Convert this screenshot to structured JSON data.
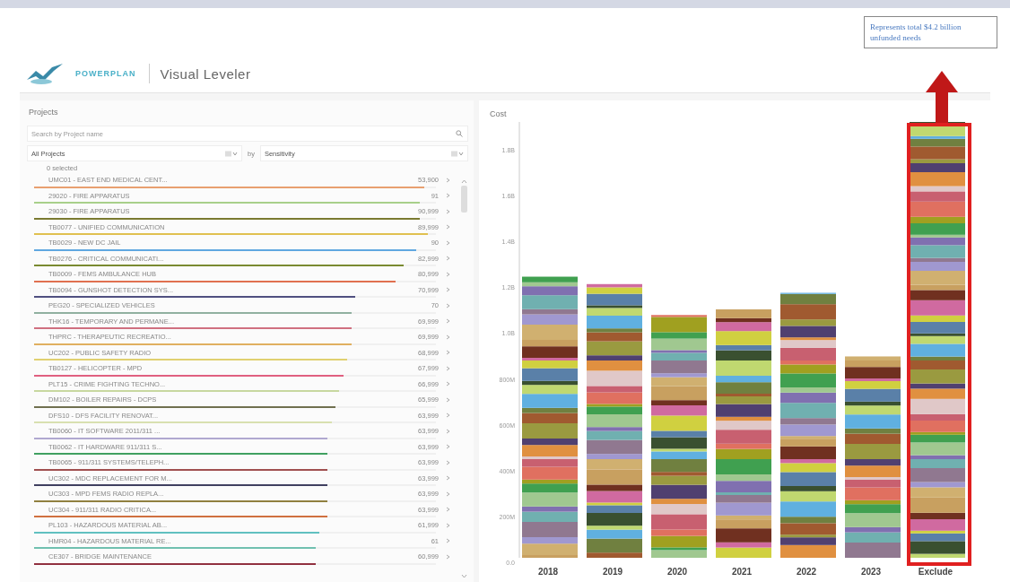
{
  "header": {
    "brand": "POWERPLAN",
    "title": "Visual Leveler"
  },
  "callout": {
    "text": "Represents total $4.2 billion unfunded needs"
  },
  "projects": {
    "title": "Projects",
    "search": {
      "placeholder": "Search by Project name"
    },
    "filter": {
      "value": "All Projects"
    },
    "by_label": "by",
    "sort": {
      "value": "Sensitivity"
    },
    "selected_count": "0 selected",
    "rows": [
      {
        "name": "UMC01 - EAST END MEDICAL CENT...",
        "value": "53,900",
        "color": "#e8a070",
        "level": 0.97
      },
      {
        "name": "29020 - FIRE APPARATUS",
        "value": "91",
        "color": "#a8d08a",
        "level": 0.96
      },
      {
        "name": "29030 - FIRE APPARATUS",
        "value": "90,999",
        "color": "#7a7a30",
        "level": 0.96
      },
      {
        "name": "TB0077 - UNIFIED COMMUNICATION",
        "value": "89,999",
        "color": "#e0c050",
        "level": 0.98
      },
      {
        "name": "TB0029 - NEW DC JAIL",
        "value": "90",
        "color": "#60a8e0",
        "level": 0.95
      },
      {
        "name": "TB0276 - CRITICAL COMMUNICATI...",
        "value": "82,999",
        "color": "#7a8a30",
        "level": 0.92
      },
      {
        "name": "TB0009 - FEMS AMBULANCE HUB",
        "value": "80,999",
        "color": "#e07050",
        "level": 0.9
      },
      {
        "name": "TB0094 - GUNSHOT DETECTION SYS...",
        "value": "70,999",
        "color": "#505080",
        "level": 0.8
      },
      {
        "name": "PEG20 - SPECIALIZED VEHICLES",
        "value": "70",
        "color": "#90b0a0",
        "level": 0.79
      },
      {
        "name": "THK16 - TEMPORARY AND PERMANE...",
        "value": "69,999",
        "color": "#d07080",
        "level": 0.79
      },
      {
        "name": "THPRC - THERAPEUTIC RECREATIO...",
        "value": "69,999",
        "color": "#e0b060",
        "level": 0.79
      },
      {
        "name": "UC202 - PUBLIC SAFETY RADIO",
        "value": "68,999",
        "color": "#e0d070",
        "level": 0.78
      },
      {
        "name": "TB0127 - HELICOPTER - MPD",
        "value": "67,999",
        "color": "#e06080",
        "level": 0.77
      },
      {
        "name": "PLT15 - CRIME FIGHTING TECHNO...",
        "value": "66,999",
        "color": "#c8d8a0",
        "level": 0.76
      },
      {
        "name": "DM102 - BOILER REPAIRS - DCPS",
        "value": "65,999",
        "color": "#707050",
        "level": 0.75
      },
      {
        "name": "DFS10 - DFS FACILITY RENOVAT...",
        "value": "63,999",
        "color": "#d8e0b0",
        "level": 0.74
      },
      {
        "name": "TB0060 - IT SOFTWARE 2011/311 ...",
        "value": "63,999",
        "color": "#b0a8d0",
        "level": 0.73
      },
      {
        "name": "TB0062 - IT HARDWARE 911/311 S...",
        "value": "63,999",
        "color": "#40a060",
        "level": 0.73
      },
      {
        "name": "TB0065 - 911/311 SYSTEMS/TELEPH...",
        "value": "63,999",
        "color": "#a05050",
        "level": 0.73
      },
      {
        "name": "UC302 - MDC REPLACEMENT FOR M...",
        "value": "63,999",
        "color": "#404060",
        "level": 0.73
      },
      {
        "name": "UC303 - MPD FEMS RADIO REPLA...",
        "value": "63,999",
        "color": "#908040",
        "level": 0.73
      },
      {
        "name": "UC304 - 911/311 RADIO CRITICA...",
        "value": "63,999",
        "color": "#d07040",
        "level": 0.73
      },
      {
        "name": "PL103 - HAZARDOUS MATERIAL AB...",
        "value": "61,999",
        "color": "#60c0c0",
        "level": 0.71
      },
      {
        "name": "HMR04 - HAZARDOUS MATERIAL RE...",
        "value": "61",
        "color": "#70c0b0",
        "level": 0.7
      },
      {
        "name": "CE307 - BRIDGE MAINTENANCE",
        "value": "60,999",
        "color": "#903040",
        "level": 0.7
      }
    ]
  },
  "cost": {
    "title": "Cost",
    "yticks": [
      "1.8B",
      "1.6B",
      "1.4B",
      "1.2B",
      "1.0B",
      "800M",
      "600M",
      "400M",
      "200M",
      "0.0"
    ],
    "categories": [
      "2018",
      "2019",
      "2020",
      "2021",
      "2022",
      "2023",
      "Exclude"
    ]
  }
}
